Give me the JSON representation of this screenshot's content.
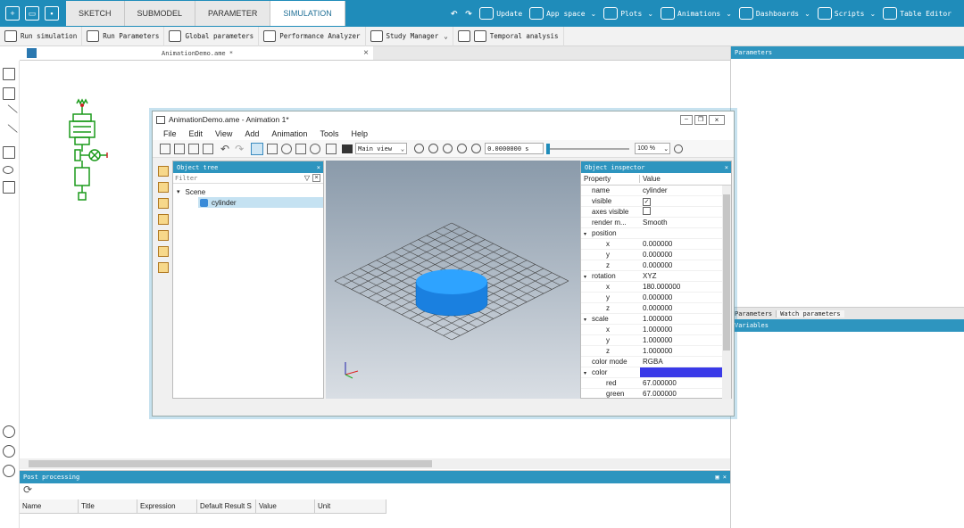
{
  "ribbon": {
    "tabs": [
      "SKETCH",
      "SUBMODEL",
      "PARAMETER",
      "SIMULATION"
    ],
    "active_tab": "SIMULATION",
    "tools": [
      "Update",
      "App space",
      "Plots",
      "Animations",
      "Dashboards",
      "Scripts",
      "Table Editor"
    ]
  },
  "toolbar": {
    "items": [
      "Run simulation",
      "Run Parameters",
      "Global parameters",
      "Performance Analyzer",
      "Study Manager",
      "Temporal analysis"
    ]
  },
  "document": {
    "tab_title": "AnimationDemo.ame *"
  },
  "right_panels": {
    "parameters_title": "Parameters",
    "tabs": [
      "Parameters",
      "Watch parameters"
    ],
    "variables_title": "Variables"
  },
  "post_processing": {
    "title": "Post processing",
    "columns": [
      "Name",
      "Title",
      "Expression",
      "Default Result S",
      "Value",
      "Unit"
    ]
  },
  "anim_window": {
    "title": "AnimationDemo.ame - Animation 1*",
    "menu": [
      "File",
      "Edit",
      "View",
      "Add",
      "Animation",
      "Tools",
      "Help"
    ],
    "view_select": "Main view",
    "time_value": "0.0000000 s",
    "zoom_value": "100 %",
    "object_tree": {
      "title": "Object tree",
      "filter_placeholder": "Filter",
      "scene_label": "Scene",
      "item_label": "cylinder"
    },
    "inspector": {
      "title": "Object inspector",
      "col_property": "Property",
      "col_value": "Value",
      "rows": [
        {
          "key": "name",
          "value": "cylinder"
        },
        {
          "key": "visible",
          "value": ""
        },
        {
          "key": "axes visible",
          "value": ""
        },
        {
          "key": "render m...",
          "value": "Smooth"
        },
        {
          "key": "position",
          "value": ""
        },
        {
          "key": "x",
          "value": "0.000000"
        },
        {
          "key": "y",
          "value": "0.000000"
        },
        {
          "key": "z",
          "value": "0.000000"
        },
        {
          "key": "rotation",
          "value": "XYZ"
        },
        {
          "key": "x",
          "value": "180.000000"
        },
        {
          "key": "y",
          "value": "0.000000"
        },
        {
          "key": "z",
          "value": "0.000000"
        },
        {
          "key": "scale",
          "value": "1.000000"
        },
        {
          "key": "x",
          "value": "1.000000"
        },
        {
          "key": "y",
          "value": "1.000000"
        },
        {
          "key": "z",
          "value": "1.000000"
        },
        {
          "key": "color mode",
          "value": "RGBA"
        },
        {
          "key": "color",
          "value": ""
        },
        {
          "key": "red",
          "value": "67.000000"
        },
        {
          "key": "green",
          "value": "67.000000"
        }
      ]
    },
    "colors": {
      "cylinder": "#1e90ff",
      "color_swatch": "#3a3ae8"
    }
  }
}
